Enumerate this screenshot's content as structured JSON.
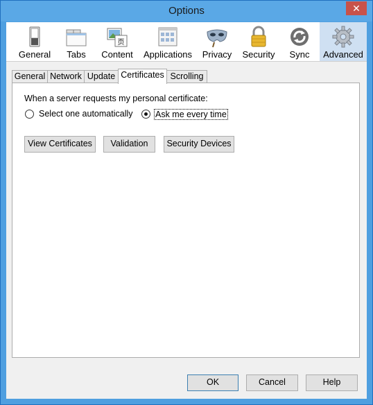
{
  "window": {
    "title": "Options",
    "close_glyph": "✕"
  },
  "panes": [
    {
      "label": "General",
      "icon": "general-switch-icon"
    },
    {
      "label": "Tabs",
      "icon": "tabs-icon"
    },
    {
      "label": "Content",
      "icon": "content-icon"
    },
    {
      "label": "Applications",
      "icon": "applications-icon"
    },
    {
      "label": "Privacy",
      "icon": "privacy-mask-icon"
    },
    {
      "label": "Security",
      "icon": "padlock-icon"
    },
    {
      "label": "Sync",
      "icon": "sync-icon"
    },
    {
      "label": "Advanced",
      "icon": "gear-icon"
    }
  ],
  "selected_pane": "Advanced",
  "subtabs": [
    "General",
    "Network",
    "Update",
    "Certificates",
    "Scrolling"
  ],
  "active_subtab": "Certificates",
  "certificates": {
    "prompt": "When a server requests my personal certificate:",
    "option_auto": "Select one automatically",
    "option_ask": "Ask me every time",
    "selected_option": "Ask me every time",
    "view_button": "View Certificates",
    "validation_button": "Validation",
    "devices_button": "Security Devices"
  },
  "footer": {
    "ok": "OK",
    "cancel": "Cancel",
    "help": "Help"
  },
  "colors": {
    "titlebar": "#5aa8e6",
    "close": "#c8524a",
    "selected_pane": "#cfe0f2"
  }
}
